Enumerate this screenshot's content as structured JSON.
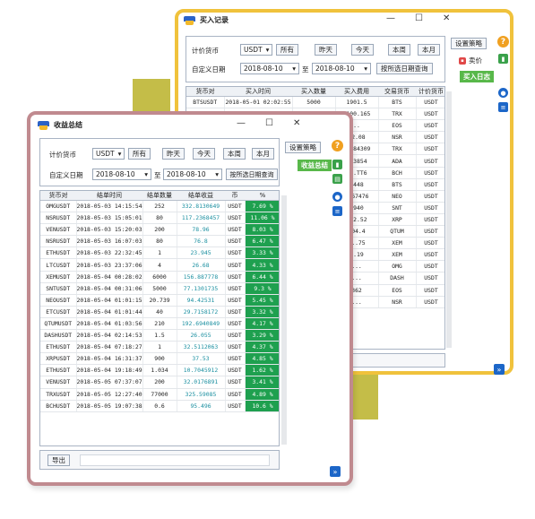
{
  "buy_window": {
    "title": "买入记录",
    "filter": {
      "price_currency_label": "计价货币",
      "currency_value": "USDT",
      "btn_all": "所有",
      "btn_yesterday": "昨天",
      "btn_today": "今天",
      "btn_this_week": "本周",
      "btn_this_month": "本月",
      "custom_date_label": "自定义日期",
      "date_from": "2018-08-10",
      "to_label": "至",
      "date_to": "2018-08-10",
      "query_button": "按所选日期查询"
    },
    "side": {
      "strategy_button": "设置策略",
      "sell_label": "卖价",
      "buy_log_tag": "买入日志"
    },
    "columns": [
      "货币对",
      "买入时间",
      "买入数量",
      "买入费用",
      "交易货币",
      "计价货币"
    ],
    "rows": [
      [
        "BTSUSDT",
        "2018-05-01 02:02:55",
        "5000",
        "1901.5",
        "BTS",
        "USDT"
      ],
      [
        "TRXUSDT",
        "2018-05-01 ...",
        "",
        "1100.165",
        "TRX",
        "USDT"
      ],
      [
        "",
        "",
        "",
        "..",
        "EOS",
        "USDT"
      ],
      [
        "",
        "",
        "",
        "22.08",
        "NSR",
        "USDT"
      ],
      [
        "",
        "",
        "",
        "3.384309",
        "TRX",
        "USDT"
      ],
      [
        "",
        "",
        "",
        "6.3854",
        "ADA",
        "USDT"
      ],
      [
        "",
        "",
        "",
        "58.TT6",
        "BCH",
        "USDT"
      ],
      [
        "",
        "",
        "",
        "3448",
        "BTS",
        "USDT"
      ],
      [
        "",
        "",
        "",
        "9.67476",
        "NEO",
        "USDT"
      ],
      [
        "",
        "",
        "",
        "2940",
        "SNT",
        "USDT"
      ],
      [
        "",
        "",
        "",
        "342.52",
        "XRP",
        "USDT"
      ],
      [
        "",
        "",
        "",
        "504.4",
        "QTUM",
        "USDT"
      ],
      [
        "",
        "",
        "",
        "...75",
        "XEM",
        "USDT"
      ],
      [
        "",
        "",
        "",
        "..19",
        "XEM",
        "USDT"
      ],
      [
        "",
        "",
        "",
        "...",
        "OMG",
        "USDT"
      ],
      [
        "",
        "",
        "",
        "...",
        "DASH",
        "USDT"
      ],
      [
        "",
        "",
        "",
        "362",
        "EOS",
        "USDT"
      ],
      [
        "",
        "",
        "",
        "...",
        "NSR",
        "USDT"
      ]
    ]
  },
  "profit_window": {
    "title": "收益总结",
    "filter": {
      "price_currency_label": "计价货币",
      "currency_value": "USDT",
      "btn_all": "所有",
      "btn_yesterday": "昨天",
      "btn_today": "今天",
      "btn_this_week": "本周",
      "btn_this_month": "本月",
      "custom_date_label": "自定义日期",
      "date_from": "2018-08-10",
      "to_label": "至",
      "date_to": "2018-08-10",
      "query_button": "按所选日期查询"
    },
    "side": {
      "profit_tag": "收益总结",
      "strategy_button": "设置策略"
    },
    "columns": [
      "货币对",
      "结单时间",
      "结单数量",
      "结单收益",
      "币",
      "%"
    ],
    "rows": [
      [
        "OMGUSDT",
        "2018-05-03 14:15:54",
        "252",
        "332.8130649",
        "USDT",
        "7.69 %"
      ],
      [
        "NSRUSDT",
        "2018-05-03 15:05:01",
        "80",
        "117.2368457",
        "USDT",
        "11.06 %"
      ],
      [
        "VENUSDT",
        "2018-05-03 15:20:03",
        "200",
        "78.96",
        "USDT",
        "8.03 %"
      ],
      [
        "NSRUSDT",
        "2018-05-03 16:07:03",
        "80",
        "76.8",
        "USDT",
        "6.47 %"
      ],
      [
        "ETHUSDT",
        "2018-05-03 22:32:45",
        "1",
        "23.945",
        "USDT",
        "3.33 %"
      ],
      [
        "LTCUSDT",
        "2018-05-03 23:37:06",
        "4",
        "26.68",
        "USDT",
        "4.33 %"
      ],
      [
        "XEMUSDT",
        "2018-05-04 00:28:02",
        "6000",
        "156.887778",
        "USDT",
        "6.44 %"
      ],
      [
        "SNTUSDT",
        "2018-05-04 00:31:06",
        "5000",
        "77.1301735",
        "USDT",
        "9.3 %"
      ],
      [
        "NEOUSDT",
        "2018-05-04 01:01:15",
        "20.739",
        "94.42531",
        "USDT",
        "5.45 %"
      ],
      [
        "ETCUSDT",
        "2018-05-04 01:01:44",
        "40",
        "29.7158172",
        "USDT",
        "3.32 %"
      ],
      [
        "QTUMUSDT",
        "2018-05-04 01:03:56",
        "210",
        "192.6940849",
        "USDT",
        "4.17 %"
      ],
      [
        "DASHUSDT",
        "2018-05-04 02:14:53",
        "1.5",
        "26.055",
        "USDT",
        "3.29 %"
      ],
      [
        "ETHUSDT",
        "2018-05-04 07:18:27",
        "1",
        "32.5112063",
        "USDT",
        "4.37 %"
      ],
      [
        "XRPUSDT",
        "2018-05-04 16:31:37",
        "900",
        "37.53",
        "USDT",
        "4.85 %"
      ],
      [
        "ETHUSDT",
        "2018-05-04 19:18:49",
        "1.034",
        "10.7045912",
        "USDT",
        "1.62 %"
      ],
      [
        "VENUSDT",
        "2018-05-05 07:37:07",
        "200",
        "32.0176891",
        "USDT",
        "3.41 %"
      ],
      [
        "TRXUSDT",
        "2018-05-05 12:27:40",
        "77000",
        "325.59085",
        "USDT",
        "4.89 %"
      ],
      [
        "BCHUSDT",
        "2018-05-05 19:07:38",
        "0.6",
        "95.496",
        "USDT",
        "10.6 %"
      ]
    ],
    "export_button": "导出"
  },
  "icon_colors": {
    "accent_blue": "#1c66c8",
    "green": "#1ea04f",
    "orange": "#f0a020"
  }
}
